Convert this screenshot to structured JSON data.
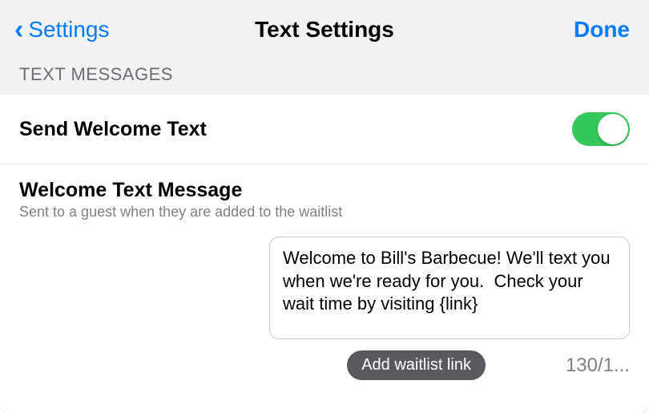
{
  "navbar": {
    "back_label": "Settings",
    "title": "Text Settings",
    "done_label": "Done"
  },
  "section_header": "TEXT MESSAGES",
  "send_welcome": {
    "label": "Send Welcome Text",
    "enabled": true
  },
  "welcome_message": {
    "title": "Welcome Text Message",
    "subtitle": "Sent to a guest when they are added to the waitlist",
    "value": "Welcome to Bill's Barbecue! We'll text you when we're ready for you.  Check your wait time by visiting {link}"
  },
  "add_link_button": "Add waitlist link",
  "char_count": "130/1..."
}
